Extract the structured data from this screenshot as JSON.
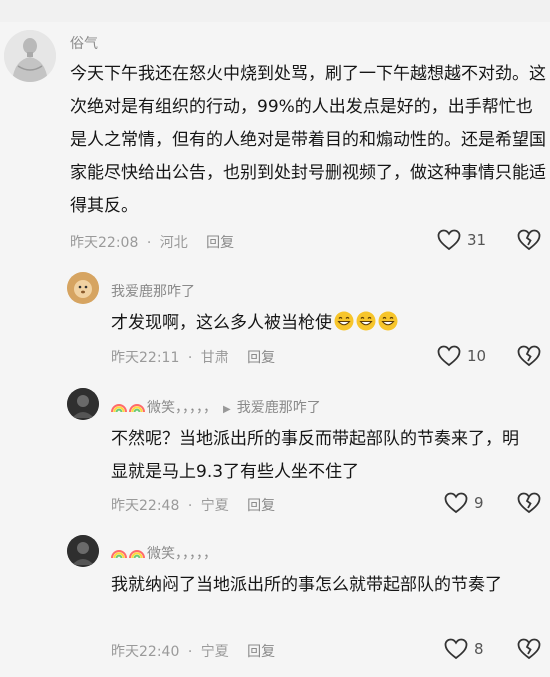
{
  "comments": [
    {
      "user": "俗气",
      "text": "今天下午我还在怒火中烧到处骂，刷了一下午越想越不对劲。这次绝对是有组织的行动，99%的人出发点是好的，出手帮忙也是人之常情，但有的人绝对是带着目的和煽动性的。还是希望国家能尽快给出公告，也别到处封号删视频了，做这种事情只能适得其反。",
      "time": "昨天22:08",
      "location": "河北",
      "reply": "回复",
      "likes": "31"
    },
    {
      "user": "我爱鹿那咋了",
      "text": "才发现啊，这么多人被当枪使",
      "time": "昨天22:11",
      "location": "甘肃",
      "reply": "回复",
      "likes": "10"
    },
    {
      "user": "微笑，，，，，",
      "reply_to": "我爱鹿那咋了",
      "text": "不然呢？当地派出所的事反而带起部队的节奏来了，明显就是马上9.3了有些人坐不住了",
      "time": "昨天22:48",
      "location": "宁夏",
      "reply": "回复",
      "likes": "9"
    },
    {
      "user": "微笑，，，，，",
      "text": "我就纳闷了当地派出所的事怎么就带起部队的节奏了",
      "time": "昨天22:40",
      "location": "宁夏",
      "reply": "回复",
      "likes": "8"
    }
  ],
  "colors": {
    "background": "#f5f5f5",
    "username": "#8a8a8a",
    "meta": "#9a9a9a",
    "text": "#161616"
  },
  "icons": [
    "heart-outline-icon",
    "broken-heart-icon",
    "grinning-emoji-icon",
    "rainbow-emoji-icon",
    "play-arrow-icon"
  ]
}
